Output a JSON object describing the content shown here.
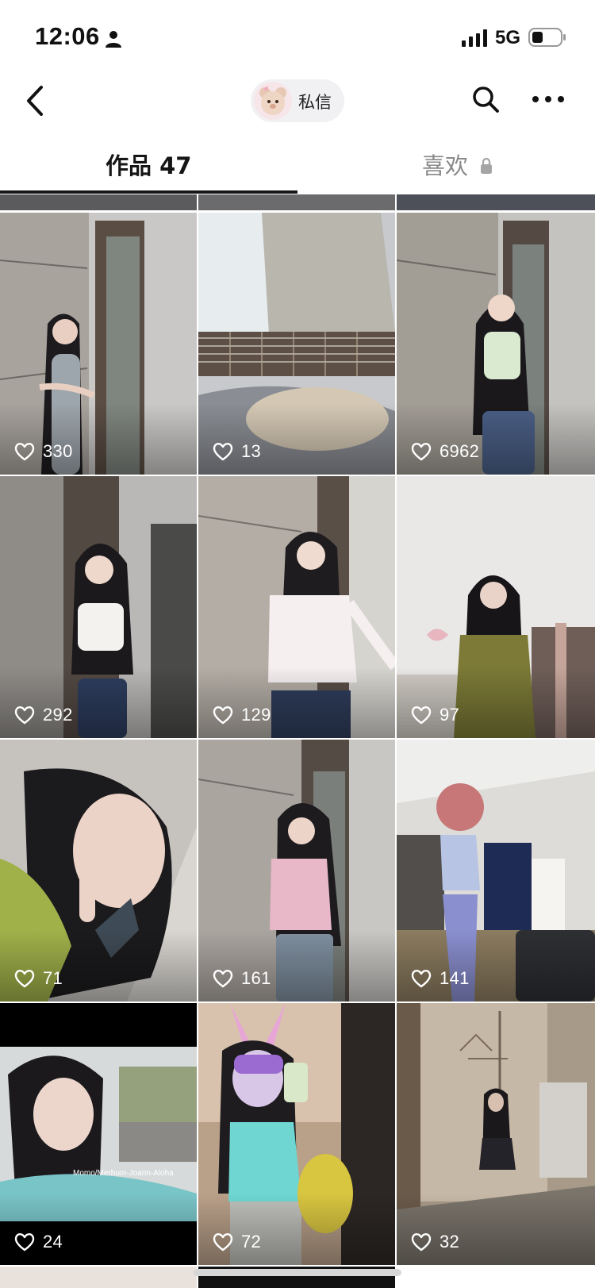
{
  "status_bar": {
    "time": "12:06",
    "network": "5G",
    "icons": [
      "person-icon",
      "signal-icon",
      "battery-icon"
    ]
  },
  "nav": {
    "back_icon": "chevron-left-icon",
    "dm_label": "私信",
    "search_icon": "search-icon",
    "more_icon": "more-icon"
  },
  "tabs": {
    "works_label": "作品 47",
    "likes_label": "喜欢",
    "likes_icon": "lock-icon",
    "active": "works"
  },
  "grid": {
    "rows": [
      [
        {
          "likes": "330"
        },
        {
          "likes": "13"
        },
        {
          "likes": "6962"
        }
      ],
      [
        {
          "likes": "292"
        },
        {
          "likes": "129"
        },
        {
          "likes": "97"
        }
      ],
      [
        {
          "likes": "71"
        },
        {
          "likes": "161"
        },
        {
          "likes": "141"
        }
      ],
      [
        {
          "likes": "24"
        },
        {
          "likes": "72"
        },
        {
          "likes": "32"
        }
      ]
    ],
    "watermark": "Momo/Merhum-Joann-Aloha"
  }
}
